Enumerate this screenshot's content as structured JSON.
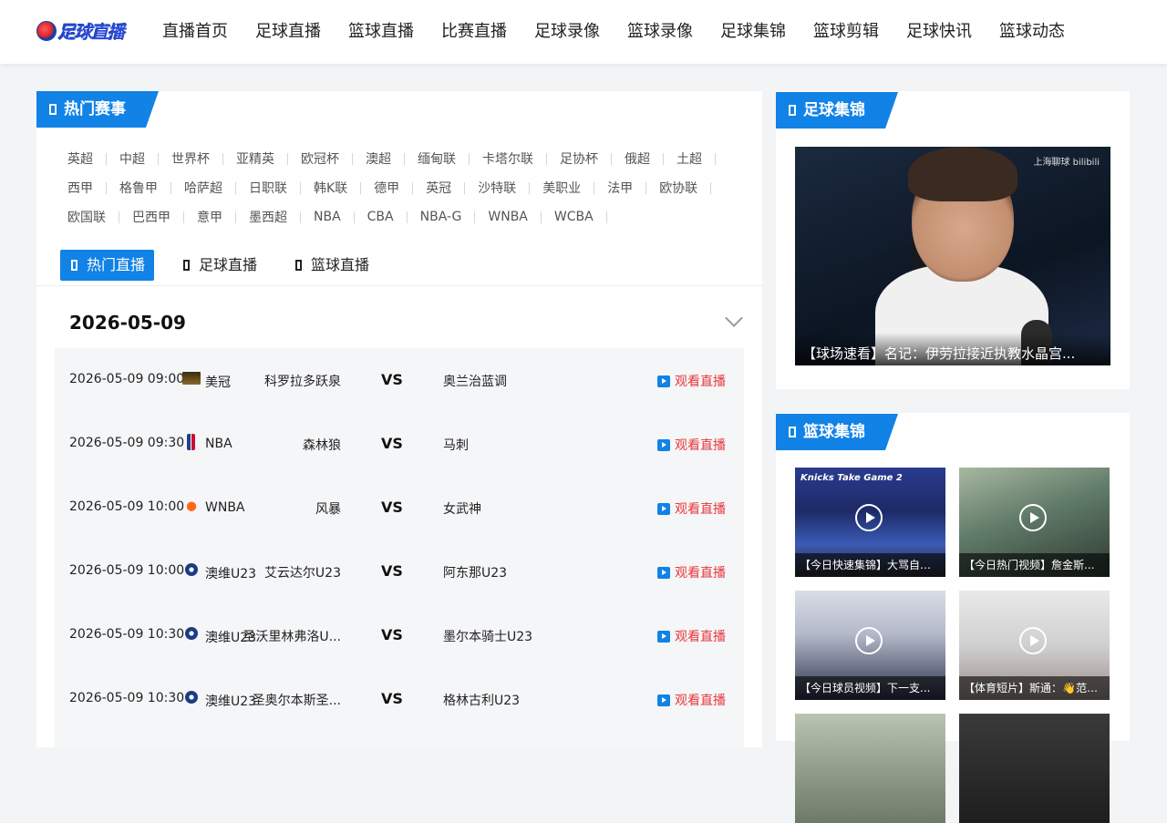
{
  "header": {
    "logo_text": "足球直播",
    "nav": [
      "直播首页",
      "足球直播",
      "篮球直播",
      "比赛直播",
      "足球录像",
      "篮球录像",
      "足球集锦",
      "篮球剪辑",
      "足球快讯",
      "篮球动态"
    ]
  },
  "hot_events": {
    "title": "热门赛事",
    "rows": [
      [
        "英超",
        "中超",
        "世界杯",
        "亚精英",
        "欧冠杯",
        "澳超",
        "缅甸联",
        "卡塔尔联",
        "足协杯",
        "俄超",
        "土超"
      ],
      [
        "西甲",
        "格鲁甲",
        "哈萨超",
        "日职联",
        "韩K联",
        "德甲",
        "英冠",
        "沙特联",
        "美职业",
        "法甲",
        "欧协联"
      ],
      [
        "欧国联",
        "巴西甲",
        "意甲",
        "墨西超",
        "NBA",
        "CBA",
        "NBA-G",
        "WNBA",
        "WCBA"
      ]
    ]
  },
  "tabs": [
    "热门直播",
    "足球直播",
    "篮球直播"
  ],
  "schedule": {
    "date": "2026-05-09",
    "vs_label": "VS",
    "watch_label": "观看直播",
    "matches": [
      {
        "time": "2026-05-09 09:00",
        "league": "美冠",
        "league_icon": "mls-icon",
        "home": "科罗拉多跃泉",
        "away": "奥兰治蓝调"
      },
      {
        "time": "2026-05-09 09:30",
        "league": "NBA",
        "league_icon": "nba-icon",
        "home": "森林狼",
        "away": "马刺"
      },
      {
        "time": "2026-05-09 10:00",
        "league": "WNBA",
        "league_icon": "wnba-icon",
        "home": "风暴",
        "away": "女武神"
      },
      {
        "time": "2026-05-09 10:00",
        "league": "澳维U23",
        "league_icon": "victoria-icon",
        "home": "艾云达尔U23",
        "away": "阿东那U23"
      },
      {
        "time": "2026-05-09 10:30",
        "league": "澳维U23",
        "league_icon": "victoria-icon",
        "home": "圣沃里林弗洛U...",
        "away": "墨尔本骑士U23"
      },
      {
        "time": "2026-05-09 10:30",
        "league": "澳维U23",
        "league_icon": "victoria-icon",
        "home": "圣奥尔本斯圣...",
        "away": "格林古利U23"
      }
    ]
  },
  "football_highlights": {
    "title": "足球集锦",
    "featured_caption": "【球场速看】名记：伊劳拉接近执教水晶宫...",
    "featured_watermark": "上海聊球 bilibili"
  },
  "basketball_highlights": {
    "title": "篮球集锦",
    "videos": [
      {
        "caption": "【今日快速集锦】大骂自由...",
        "banner": "Knicks Take Game 2"
      },
      {
        "caption": "【今日热门视频】詹金斯..."
      },
      {
        "caption": "【今日球员视频】下一支..."
      },
      {
        "caption": "【体育短片】斯通：👋范乔..."
      },
      {
        "caption": ""
      },
      {
        "caption": ""
      }
    ]
  },
  "colors": {
    "accent": "#1182e6",
    "watch_text": "#e8373b"
  }
}
